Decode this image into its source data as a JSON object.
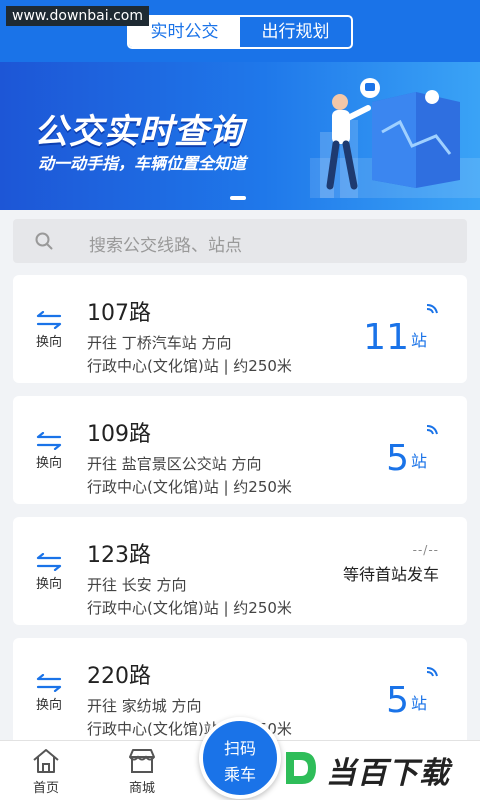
{
  "watermark": {
    "site": "www.downbai.com",
    "brand": "当百下载"
  },
  "header": {
    "tabs": [
      {
        "label": "实时公交",
        "active": true
      },
      {
        "label": "出行规划",
        "active": false
      }
    ]
  },
  "banner": {
    "title": "公交实时查询",
    "subtitle": "动一动手指，车辆位置全知道"
  },
  "search": {
    "placeholder": "搜索公交线路、站点",
    "icon": "search-icon"
  },
  "routes": [
    {
      "swap_label": "换向",
      "name": "107路",
      "direction": "开往 丁桥汽车站 方向",
      "stop": "行政中心(文化馆)站 | 约250米",
      "count": "11",
      "unit": "站",
      "status": ""
    },
    {
      "swap_label": "换向",
      "name": "109路",
      "direction": "开往 盐官景区公交站 方向",
      "stop": "行政中心(文化馆)站 | 约250米",
      "count": "5",
      "unit": "站",
      "status": ""
    },
    {
      "swap_label": "换向",
      "name": "123路",
      "direction": "开往 长安 方向",
      "stop": "行政中心(文化馆)站 | 约250米",
      "count": "",
      "unit": "",
      "status": "等待首站发车",
      "placeholder": "--/--"
    },
    {
      "swap_label": "换向",
      "name": "220路",
      "direction": "开往 家纺城 方向",
      "stop": "行政中心(文化馆)站 | 约250米",
      "count": "5",
      "unit": "站",
      "status": ""
    }
  ],
  "tabbar": {
    "items": [
      {
        "label": "首页",
        "icon": "home-icon"
      },
      {
        "label": "商城",
        "icon": "store-icon"
      }
    ],
    "scan": {
      "line1": "扫码",
      "line2": "乘车"
    }
  },
  "colors": {
    "primary": "#1a73e8",
    "background": "#f1f3f6"
  }
}
